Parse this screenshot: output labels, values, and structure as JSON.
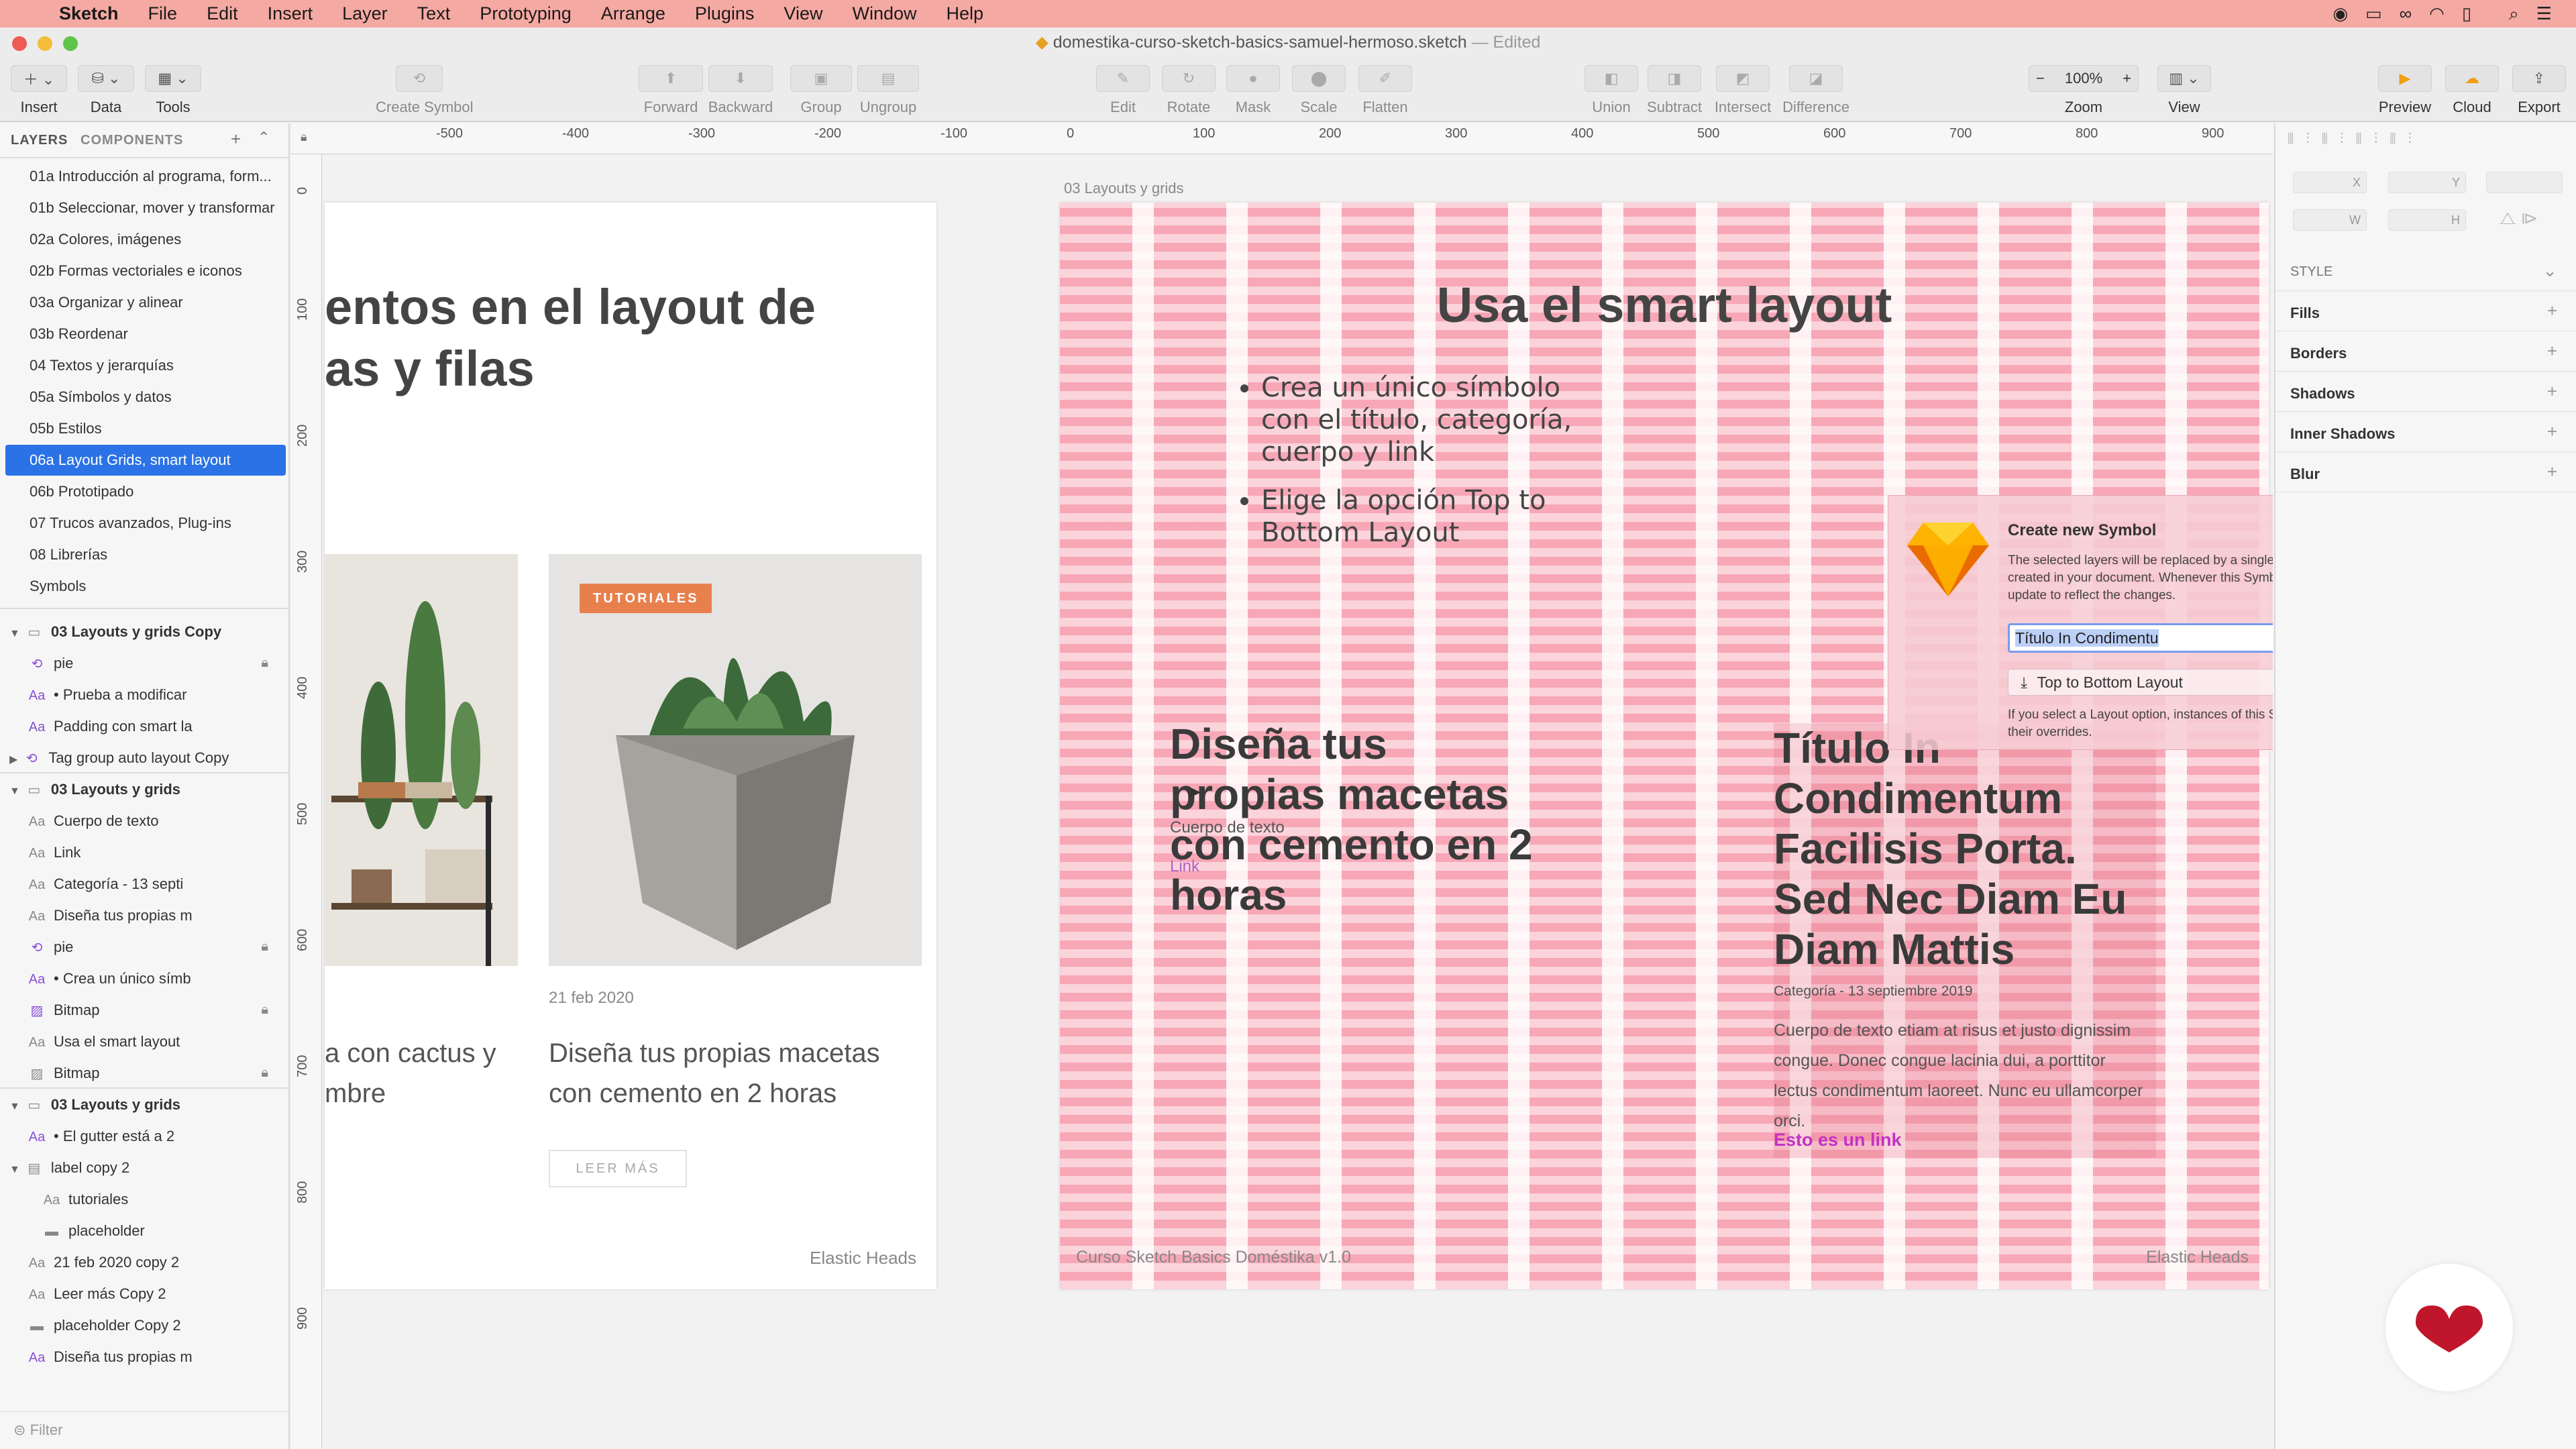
{
  "menubar": {
    "apple_icon": "apple-icon",
    "items": [
      "Sketch",
      "File",
      "Edit",
      "Insert",
      "Layer",
      "Text",
      "Prototyping",
      "Arrange",
      "Plugins",
      "View",
      "Window",
      "Help"
    ]
  },
  "window": {
    "title": "domestika-curso-sketch-basics-samuel-hermoso.sketch",
    "status": "— Edited"
  },
  "toolbar": {
    "insert": "Insert",
    "data": "Data",
    "tools": "Tools",
    "create_symbol": "Create Symbol",
    "forward": "Forward",
    "backward": "Backward",
    "group": "Group",
    "ungroup": "Ungroup",
    "edit": "Edit",
    "rotate": "Rotate",
    "mask": "Mask",
    "scale": "Scale",
    "flatten": "Flatten",
    "union": "Union",
    "subtract": "Subtract",
    "intersect": "Intersect",
    "difference": "Difference",
    "zoom_value": "100%",
    "zoom": "Zoom",
    "view": "View",
    "preview": "Preview",
    "cloud": "Cloud",
    "export": "Export"
  },
  "left_panel": {
    "tab_layers": "LAYERS",
    "tab_components": "COMPONENTS",
    "pages": [
      "01a Introducción al programa, form...",
      "01b Seleccionar, mover y transformar",
      "02a Colores, imágenes",
      "02b Formas vectoriales e iconos",
      "03a Organizar y alinear",
      "03b Reordenar",
      "04 Textos y jerarquías",
      "05a Símbolos y datos",
      "05b Estilos",
      "06a Layout Grids, smart layout",
      "06b Prototipado",
      "07 Trucos avanzados, Plug-ins",
      "08 Librerías",
      "Symbols"
    ],
    "layers": [
      {
        "label": "03 Layouts y grids Copy"
      },
      {
        "label": "pie"
      },
      {
        "label": "• Prueba a modificar"
      },
      {
        "label": "Padding con smart la"
      },
      {
        "label": "Tag group auto layout Copy"
      },
      {
        "label": "03 Layouts y grids"
      },
      {
        "label": "Cuerpo de texto"
      },
      {
        "label": "Link"
      },
      {
        "label": "Categoría - 13 septi"
      },
      {
        "label": "Diseña tus propias m"
      },
      {
        "label": "pie"
      },
      {
        "label": "• Crea un único símb"
      },
      {
        "label": "Bitmap"
      },
      {
        "label": "Usa el smart layout"
      },
      {
        "label": "Bitmap"
      },
      {
        "label": "03 Layouts y grids"
      },
      {
        "label": "• El gutter está a 2"
      },
      {
        "label": "label copy 2"
      },
      {
        "label": "tutoriales"
      },
      {
        "label": "placeholder"
      },
      {
        "label": "21 feb 2020 copy 2"
      },
      {
        "label": "Leer más Copy 2"
      },
      {
        "label": "placeholder Copy 2"
      },
      {
        "label": "Diseña tus propias m"
      }
    ],
    "filter_placeholder": "Filter"
  },
  "rulers": {
    "h": [
      "-500",
      "-400",
      "-300",
      "-200",
      "-100",
      "0",
      "100",
      "200",
      "300",
      "400",
      "500",
      "600",
      "700",
      "800",
      "900"
    ],
    "v": [
      "0",
      "100",
      "200",
      "300",
      "400",
      "500",
      "600",
      "700",
      "800",
      "900"
    ]
  },
  "artboard_left": {
    "heading": "entos en el layout de\nas y filas",
    "tag": "TUTORIALES",
    "date": "21 feb 2020",
    "card_title_left": "a con cactus y\nmbre",
    "card_title": "Diseña tus propias macetas con cemento en 2 horas",
    "read_more": "LEER MÁS",
    "footer": "Elastic Heads"
  },
  "artboard_right": {
    "name": "03 Layouts y grids",
    "title": "Usa el smart layout",
    "bullets": [
      "Crea un único símbolo con el título, categoría, cuerpo y link",
      "Elige la opción Top to Bottom Layout"
    ],
    "big_left": "Diseña tus propias macetas con cemento en 2 horas",
    "overlay_body": "Cuerpo de texto",
    "overlay_link": "Link",
    "card_title": "Título In Condimentum Facilisis Porta. Sed Nec Diam Eu Diam Mattis",
    "category": "Categoría - 13 septiembre 2019",
    "body": "Cuerpo de texto etiam at risus et justo dignissim congue. Donec congue lacinia dui, a porttitor lectus condimentum laoreet. Nunc eu ullamcorper orci.",
    "link": "Esto es un link",
    "footer_left": "Curso Sketch Basics Doméstika v1.0",
    "footer_right": "Elastic Heads"
  },
  "dialog": {
    "title": "Create new Symbol",
    "desc": "The selected layers will be replaced by a single layer. A new Symbol will be created in your document. Whenever this Symbol is edited, all its layers will update to reflect the changes.",
    "name_value": "Título In Condimentu",
    "layout_option": "Top to Bottom Layout",
    "note": "If you select a Layout option, instances of this Symbol will resize when you edit their overrides."
  },
  "right_panel": {
    "fields": [
      "X",
      "Y",
      "W",
      "H"
    ],
    "style": "STYLE",
    "sections": [
      "Fills",
      "Borders",
      "Shadows",
      "Inner Shadows",
      "Blur"
    ]
  },
  "colors": {
    "menubar": "#f5a9a3",
    "selection": "#2a72e6",
    "tag": "#e8804e",
    "link": "#c431c4",
    "brand": "#c0162c"
  }
}
